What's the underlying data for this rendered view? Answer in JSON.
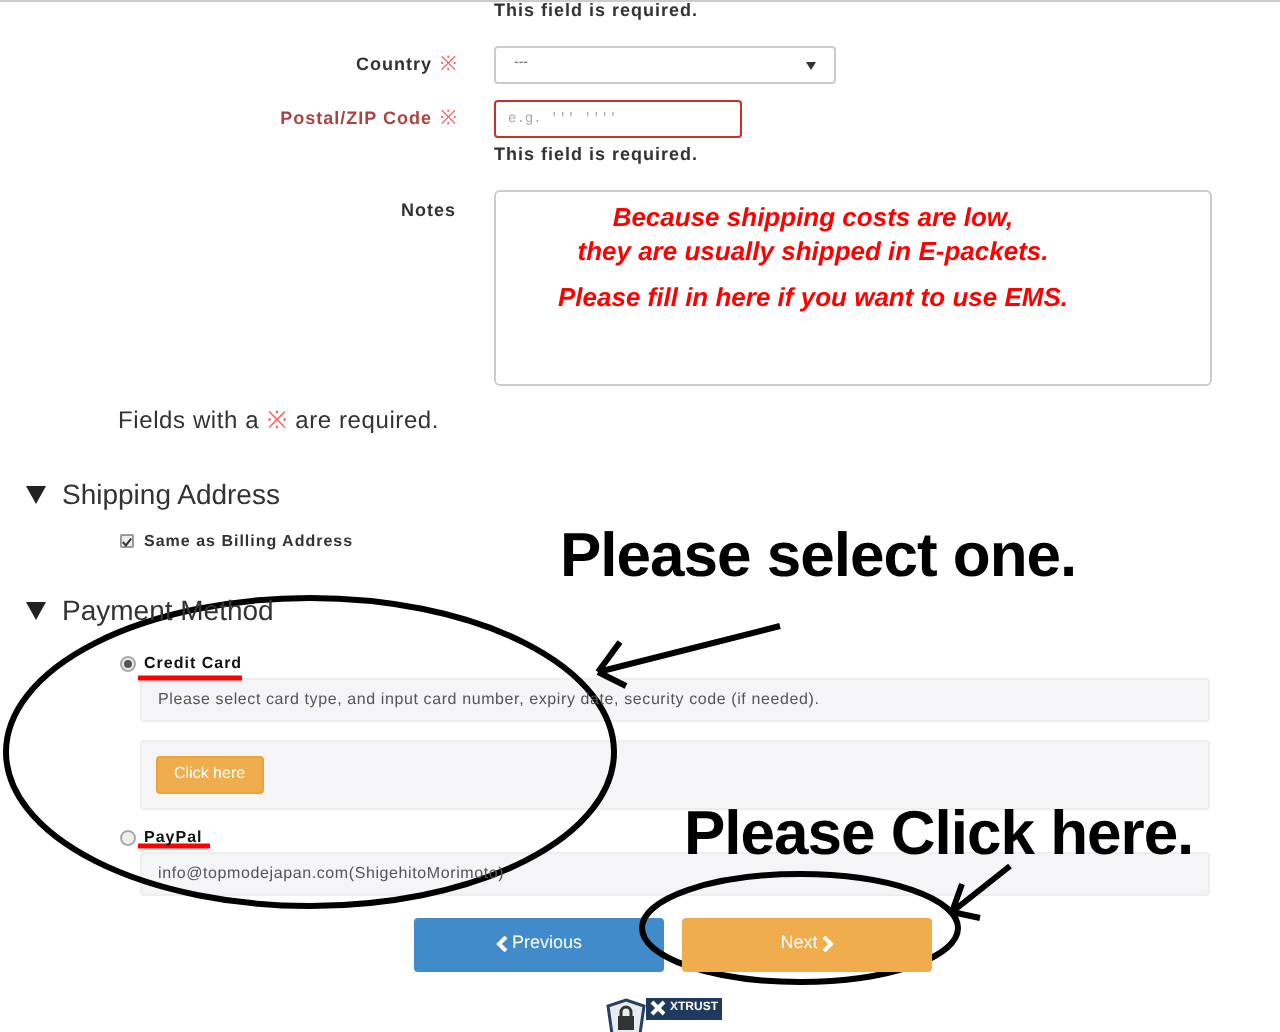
{
  "top_error": "This field is required.",
  "country": {
    "label": "Country",
    "mark": "※",
    "value": "---"
  },
  "postal": {
    "label": "Postal/ZIP Code",
    "mark": "※",
    "placeholder": "e.g. ''' ''''",
    "error": "This field is required."
  },
  "notes": {
    "label": "Notes",
    "lines": [
      "Because shipping costs are low,",
      "they are usually shipped in E-packets.",
      "Please fill in here if you want to use EMS."
    ]
  },
  "required_note": {
    "before": "Fields with a",
    "mark": "※",
    "after": "are required."
  },
  "shipping": {
    "title": "Shipping Address",
    "expanded": true,
    "checkbox": {
      "label": "Same as Billing Address",
      "checked": true
    }
  },
  "payment": {
    "title": "Payment Method",
    "expanded": true,
    "options": [
      {
        "label": "Credit Card",
        "selected": true,
        "description": "Please select card type, and input card number, expiry date, security code (if needed).",
        "button": "Click here"
      },
      {
        "label": "PayPal",
        "selected": false,
        "description": "info@topmodejapan.com(ShigehitoMorimoto)"
      }
    ]
  },
  "buttons": {
    "previous": "Previous",
    "next": "Next"
  },
  "badge": "XTRUST",
  "annotations": {
    "select_hint": "Please select one.",
    "click_hint": "Please Click here."
  }
}
